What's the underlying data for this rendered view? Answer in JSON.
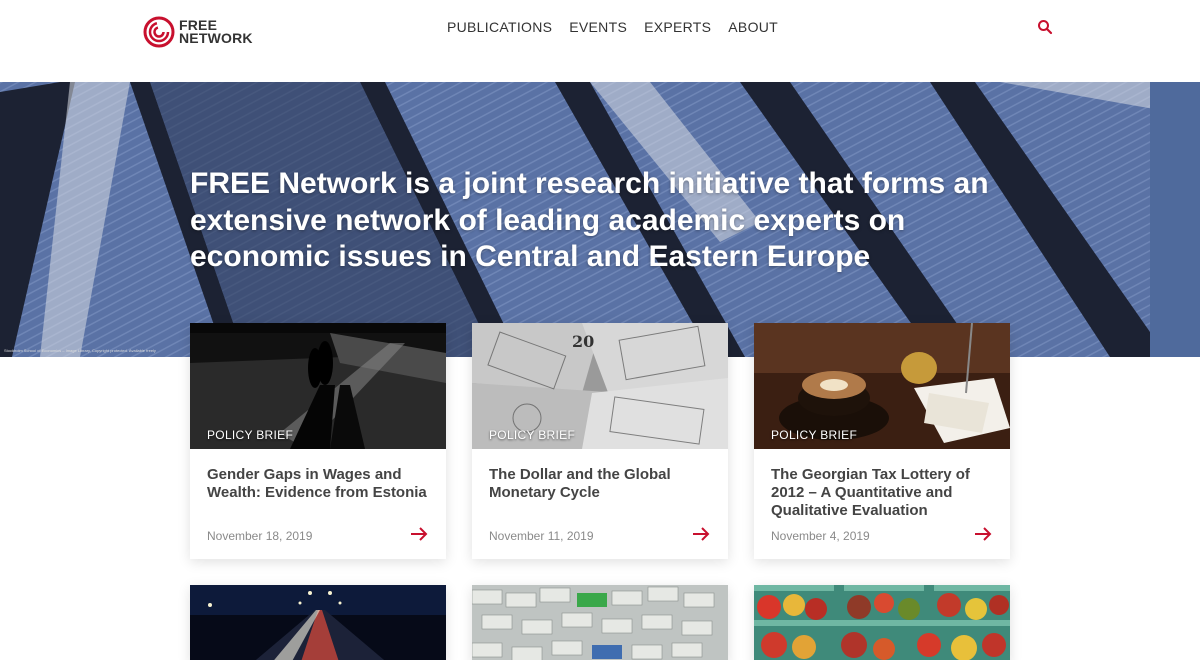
{
  "brand": {
    "line1": "FREE",
    "line2": "NETWORK",
    "accent": "#c8102e"
  },
  "nav": [
    {
      "label": "PUBLICATIONS"
    },
    {
      "label": "EVENTS"
    },
    {
      "label": "EXPERTS"
    },
    {
      "label": "ABOUT"
    }
  ],
  "search": {
    "icon": "search-icon"
  },
  "hero": {
    "title": "FREE Network is a joint research initiative that forms an extensive network of leading academic experts on economic issues in Central and Eastern Europe",
    "credit": "Stockholm School of Economics – Image Library, Copyright protected. Available freely"
  },
  "cards": [
    {
      "tag": "POLICY BRIEF",
      "title": "Gender Gaps in Wages and Wealth: Evidence from Estonia",
      "date": "November 18, 2019",
      "image": "night-street-photo"
    },
    {
      "tag": "POLICY BRIEF",
      "title": "The Dollar and the Global Monetary Cycle",
      "date": "November 11, 2019",
      "image": "dollar-bills-photo"
    },
    {
      "tag": "POLICY BRIEF",
      "title": "The Georgian Tax Lottery of 2012 – A Quantitative and Qualitative Evaluation",
      "date": "November 4, 2019",
      "image": "coffee-receipts-photo"
    }
  ],
  "next_cards": [
    {
      "image": "highway-night-photo"
    },
    {
      "image": "shipping-containers-photo"
    },
    {
      "image": "tomatoes-market-photo"
    }
  ]
}
